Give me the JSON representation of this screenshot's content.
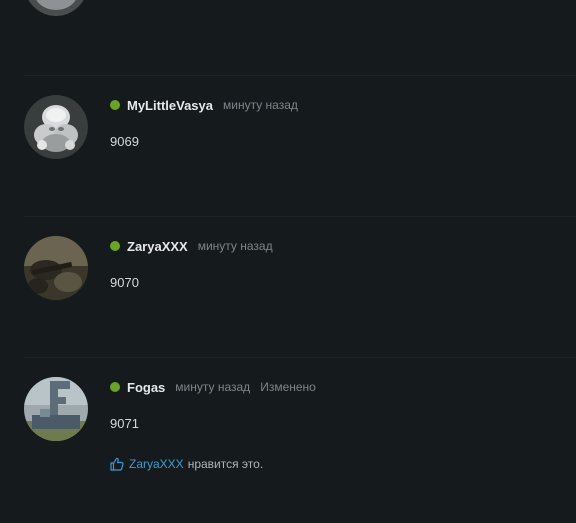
{
  "posts": [
    {
      "username": "MyLittleVasya",
      "time": "минуту назад",
      "body": "9069",
      "status_color": "#6aa520"
    },
    {
      "username": "ZaryaXXX",
      "time": "минуту назад",
      "body": "9070",
      "status_color": "#6aa520"
    },
    {
      "username": "Fogas",
      "time": "минуту назад",
      "edited": "Изменено",
      "body": "9071",
      "status_color": "#6aa520",
      "likes": {
        "user": "ZaryaXXX",
        "text": "нравится это.",
        "icon": "thumbs-up-icon"
      }
    }
  ],
  "colors": {
    "background": "#151a1c",
    "link": "#3d9ad6",
    "meta": "#7d8689",
    "online": "#6aa520"
  }
}
